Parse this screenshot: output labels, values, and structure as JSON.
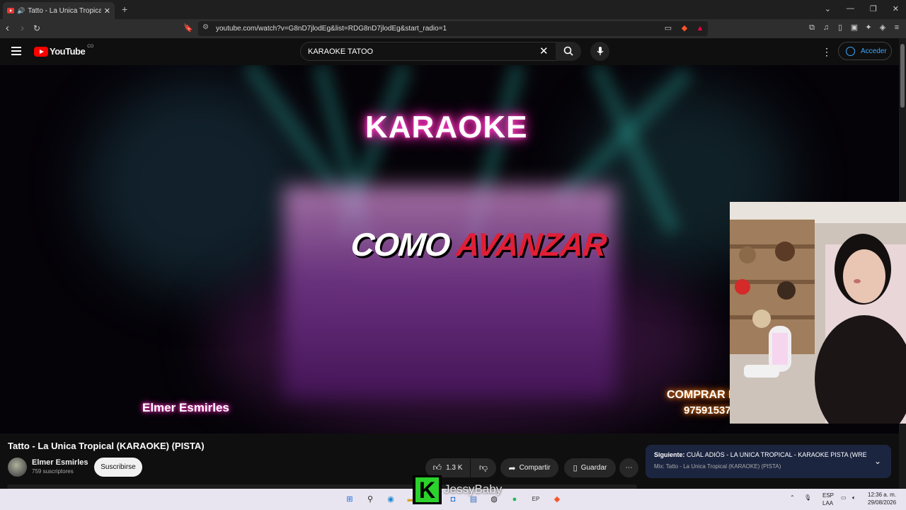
{
  "browser": {
    "tab_title": "Tatto - La Unica Tropical (KAR",
    "tab_speaker": "🔊",
    "new_tab": "+",
    "url": "youtube.com/watch?v=G8nD7jlodEg&list=RDG8nD7jlodEg&start_radio=1",
    "window_controls": [
      "⌄",
      "—",
      "❐",
      "✕"
    ]
  },
  "youtube": {
    "logo_text": "YouTube",
    "country_code": "CO",
    "search_value": "KARAOKE  TATOO",
    "sign_in_label": "Acceder"
  },
  "video_overlay": {
    "karaoke": "KARAOKE",
    "como": "COMO",
    "avanzar": "AVANZAR",
    "credit": "Elmer Esmirles",
    "buy": "COMPRAR P",
    "phone": "97591537"
  },
  "video": {
    "title": "Tatto - La Unica Tropical (KARAOKE) (PISTA)",
    "channel": "Elmer Esmirles",
    "subscribers": "759 suscriptores",
    "subscribe_label": "Suscribirse",
    "likes": "1.3 K",
    "share_label": "Compartir",
    "save_label": "Guardar"
  },
  "next_up": {
    "prefix": "Siguiente:",
    "title": "CUÁL ADIÓS - LA UNICA TROPICAL - KARAOKE PISTA (WRE...",
    "mix": "Mix: Tatto - La Unica Tropical (KARAOKE) (PISTA)"
  },
  "stream_overlay": {
    "logo_letter": "K",
    "name": "JessyBaby"
  },
  "taskbar": {
    "lang": "ESP",
    "layout": "LAA",
    "time": "12:36 a. m.",
    "date": "29/08/2026"
  },
  "colors": {
    "yt_red": "#ff0000",
    "link_blue": "#3ea6ff",
    "neon_pink": "#ff2ab8",
    "avanzar_red": "#e01f36",
    "next_bg": "#1c2540",
    "kick_green": "#2bd22b"
  }
}
